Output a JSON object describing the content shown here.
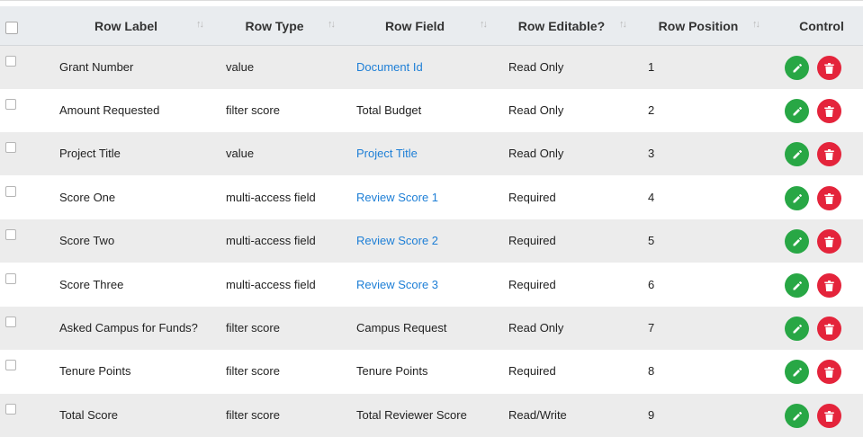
{
  "columns": [
    {
      "label": "Row Label",
      "sortable": true
    },
    {
      "label": "Row Type",
      "sortable": true
    },
    {
      "label": "Row Field",
      "sortable": true
    },
    {
      "label": "Row Editable?",
      "sortable": true
    },
    {
      "label": "Row Position",
      "sortable": true
    },
    {
      "label": "Control",
      "sortable": false
    }
  ],
  "sort_glyph": "↑↓",
  "colors": {
    "header_bg": "#e9ecef",
    "row_alt_bg": "#ececec",
    "link": "#1e7fd6",
    "edit_button": "#28a745",
    "delete_button": "#e4243b"
  },
  "rows": [
    {
      "label": "Grant Number",
      "type": "value",
      "field": "Document Id",
      "field_is_link": true,
      "editable": "Read Only",
      "position": "1"
    },
    {
      "label": "Amount Requested",
      "type": "filter score",
      "field": "Total Budget",
      "field_is_link": false,
      "editable": "Read Only",
      "position": "2"
    },
    {
      "label": "Project Title",
      "type": "value",
      "field": "Project Title",
      "field_is_link": true,
      "editable": "Read Only",
      "position": "3"
    },
    {
      "label": "Score One",
      "type": "multi-access field",
      "field": "Review Score 1",
      "field_is_link": true,
      "editable": "Required",
      "position": "4"
    },
    {
      "label": "Score Two",
      "type": "multi-access field",
      "field": "Review Score 2",
      "field_is_link": true,
      "editable": "Required",
      "position": "5"
    },
    {
      "label": "Score Three",
      "type": "multi-access field",
      "field": "Review Score 3",
      "field_is_link": true,
      "editable": "Required",
      "position": "6"
    },
    {
      "label": "Asked Campus for Funds?",
      "type": "filter score",
      "field": "Campus Request",
      "field_is_link": false,
      "editable": "Read Only",
      "position": "7"
    },
    {
      "label": "Tenure Points",
      "type": "filter score",
      "field": "Tenure Points",
      "field_is_link": false,
      "editable": "Required",
      "position": "8"
    },
    {
      "label": "Total Score",
      "type": "filter score",
      "field": "Total Reviewer Score",
      "field_is_link": false,
      "editable": "Read/Write",
      "position": "9"
    }
  ],
  "icons": {
    "edit": "pencil-icon",
    "delete": "trash-icon"
  }
}
